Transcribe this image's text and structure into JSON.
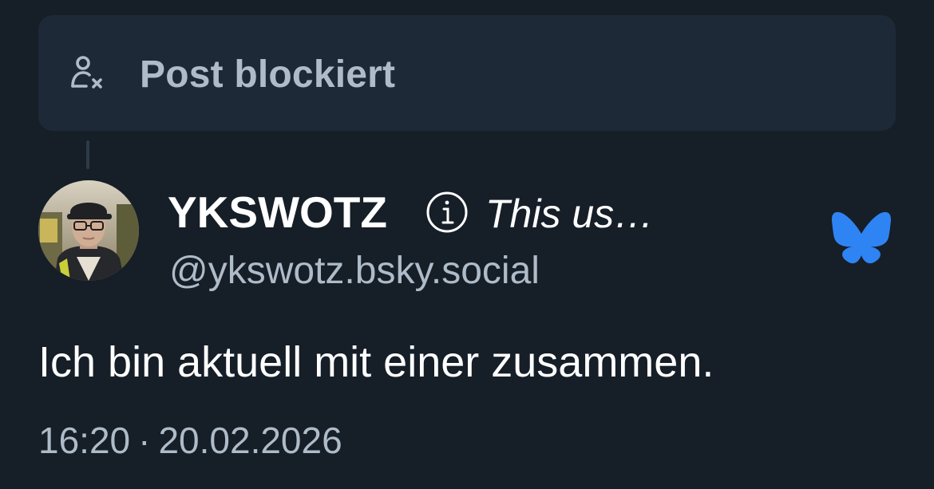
{
  "blocked_notice": {
    "label": "Post blockiert",
    "icon": "person-blocked-icon"
  },
  "author": {
    "display_name": "YKSWOTZ",
    "label_icon": "info-icon",
    "label_text": "This us…",
    "handle": "@ykswotz.bsky.social",
    "avatar": "avatar-photo"
  },
  "source_icon": "bluesky-butterfly-icon",
  "post": {
    "text": "Ich bin aktuell mit einer zusammen."
  },
  "meta": {
    "time": "16:20",
    "separator": "·",
    "date": "20.02.2026"
  },
  "colors": {
    "background": "#161e27",
    "card": "#1e2937",
    "muted_text": "#aebbc9",
    "primary_text": "#ffffff",
    "bluesky_blue": "#2f84f4"
  }
}
